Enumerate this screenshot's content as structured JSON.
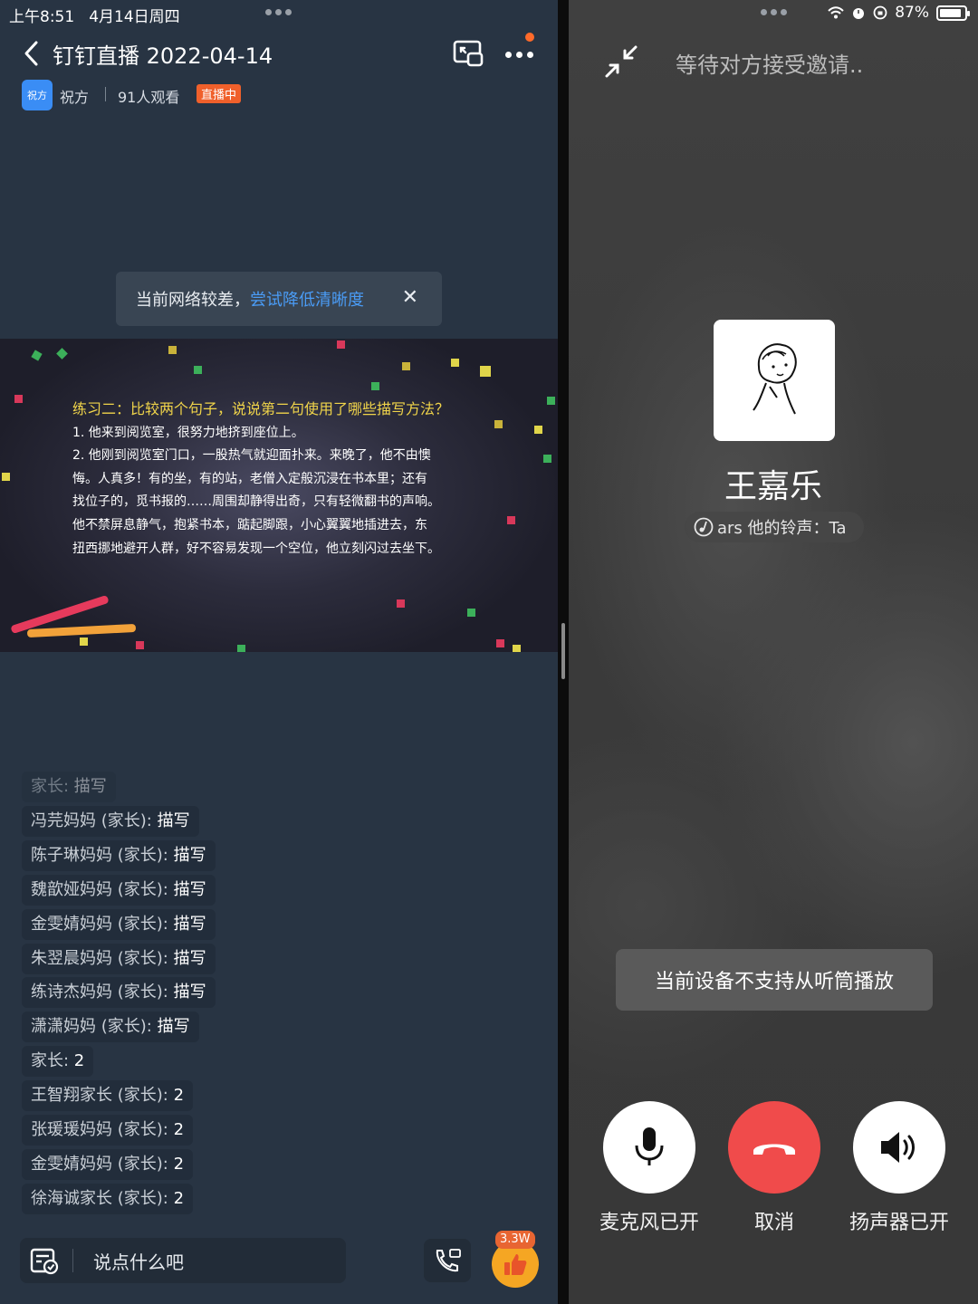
{
  "status_bar": {
    "time": "上午8:51",
    "date": "4月14日周四",
    "battery": "87%",
    "battery_level": 0.87
  },
  "live": {
    "title": "钉钉直播 2022-04-14",
    "host_avatar_text": "祝方",
    "host_name": "祝方",
    "viewers": "91人观看",
    "status_badge": "直播中",
    "network_toast": {
      "text": "当前网络较差，",
      "link": "尝试降低清晰度"
    },
    "slide": {
      "question": "练习二：比较两个句子，说说第二句使用了哪些描写方法？",
      "lines": [
        "1. 他来到阅览室，很努力地挤到座位上。",
        "2. 他刚到阅览室门口，一股热气就迎面扑来。来晚了，他不由懊",
        "悔。人真多！有的坐，有的站，老僧入定般沉浸在书本里；还有",
        "找位子的，觅书报的……周围却静得出奇，只有轻微翻书的声响。",
        "他不禁屏息静气，抱紧书本，踮起脚跟，小心翼翼地插进去，东",
        "扭西挪地避开人群，好不容易发现一个空位，他立刻闪过去坐下。"
      ]
    },
    "chat": [
      {
        "user": "家长",
        "message": "描写"
      },
      {
        "user": "冯芫妈妈 (家长)",
        "message": "描写"
      },
      {
        "user": "陈子琳妈妈 (家长)",
        "message": "描写"
      },
      {
        "user": "魏歆娅妈妈 (家长)",
        "message": "描写"
      },
      {
        "user": "金雯婧妈妈 (家长)",
        "message": "描写"
      },
      {
        "user": "朱翌晨妈妈 (家长)",
        "message": "描写"
      },
      {
        "user": "练诗杰妈妈 (家长)",
        "message": "描写"
      },
      {
        "user": "潇潇妈妈 (家长)",
        "message": "描写"
      },
      {
        "user": "家长",
        "message": "2"
      },
      {
        "user": "王智翔家长 (家长)",
        "message": "2"
      },
      {
        "user": "张瑗瑗妈妈 (家长)",
        "message": "2"
      },
      {
        "user": "金雯婧妈妈 (家长)",
        "message": "2"
      },
      {
        "user": "徐海诚家长 (家长)",
        "message": "2"
      }
    ],
    "input_placeholder": "说点什么吧",
    "like_count": "3.3W"
  },
  "call": {
    "waiting_text": "等待对方接受邀请..",
    "callee_name": "王嘉乐",
    "ringtone_text": "ars   他的铃声：Ta",
    "device_toast": "当前设备不支持从听筒播放",
    "buttons": [
      {
        "label": "麦克风已开",
        "icon": "microphone-icon"
      },
      {
        "label": "取消",
        "icon": "hang-up-icon"
      },
      {
        "label": "扬声器已开",
        "icon": "speaker-icon"
      }
    ]
  },
  "colors": {
    "live_bg": "#283443",
    "live_badge": "#f0602b",
    "link_blue": "#4a9cf6",
    "hangup_red": "#f04b4b",
    "like_orange": "#f5a623"
  }
}
